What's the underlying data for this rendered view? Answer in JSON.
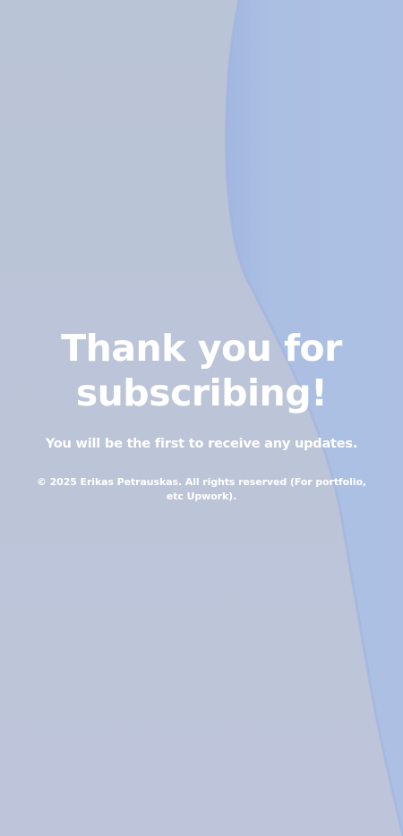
{
  "page": {
    "heading": "Thank you for subscribing!",
    "message": "You will be the first to receive any updates.",
    "copyright": "© 2025 Erikas Petrauskas. All rights reserved (For portfolio, etc Upwork)."
  },
  "colors": {
    "background": "#bcc5d8",
    "accent_shape": "#a9bde2",
    "text": "#ffffff"
  }
}
